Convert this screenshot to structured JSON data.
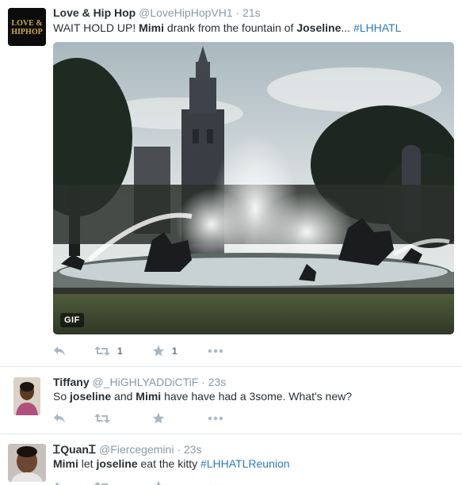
{
  "tweets": [
    {
      "name": "Love & Hip Hop",
      "handle": "@LoveHipHopVH1",
      "sep": "·",
      "time": "21s",
      "avatar_lines": [
        "LOVE &",
        "HIPHOP"
      ],
      "text": [
        {
          "t": "WAIT HOLD UP! ",
          "s": "plain"
        },
        {
          "t": "Mimi",
          "s": "bold"
        },
        {
          "t": " drank from the fountain of ",
          "s": "plain"
        },
        {
          "t": "Joseline",
          "s": "bold"
        },
        {
          "t": "... ",
          "s": "plain"
        },
        {
          "t": "#LHHATL",
          "s": "hashtag"
        }
      ],
      "media_badge": "GIF",
      "actions": {
        "reply_icon": "reply-icon",
        "retweet_icon": "retweet-icon",
        "retweet_count": "1",
        "favorite_icon": "star-icon",
        "favorite_count": "1",
        "more_icon": "more-icon"
      }
    },
    {
      "name": "Tiffany",
      "handle": "@_HiGHLYADDiCTiF",
      "sep": "·",
      "time": "23s",
      "text": [
        {
          "t": "So ",
          "s": "plain"
        },
        {
          "t": "joseline",
          "s": "bold"
        },
        {
          "t": " and ",
          "s": "plain"
        },
        {
          "t": "Mimi",
          "s": "bold"
        },
        {
          "t": " have have had a 3some. What's new?",
          "s": "plain"
        }
      ],
      "actions": {
        "reply_icon": "reply-icon",
        "retweet_icon": "retweet-icon",
        "favorite_icon": "star-icon",
        "more_icon": "more-icon"
      }
    },
    {
      "name": "ᏆQuanᏆ",
      "handle": "@Fiercegemini",
      "sep": "·",
      "time": "23s",
      "text": [
        {
          "t": "Mimi",
          "s": "bold"
        },
        {
          "t": " let ",
          "s": "plain"
        },
        {
          "t": "joseline",
          "s": "bold"
        },
        {
          "t": " eat the kitty ",
          "s": "plain"
        },
        {
          "t": "#LHHATLReunion",
          "s": "hashtag"
        }
      ],
      "actions": {
        "reply_icon": "reply-icon",
        "retweet_icon": "retweet-icon",
        "favorite_icon": "star-icon",
        "more_icon": "more-icon"
      }
    }
  ],
  "colors": {
    "text": "#292f33",
    "muted": "#8899a6",
    "link": "#2b7bb9",
    "icon": "#aab8c2",
    "divider": "#e1e8ed"
  }
}
